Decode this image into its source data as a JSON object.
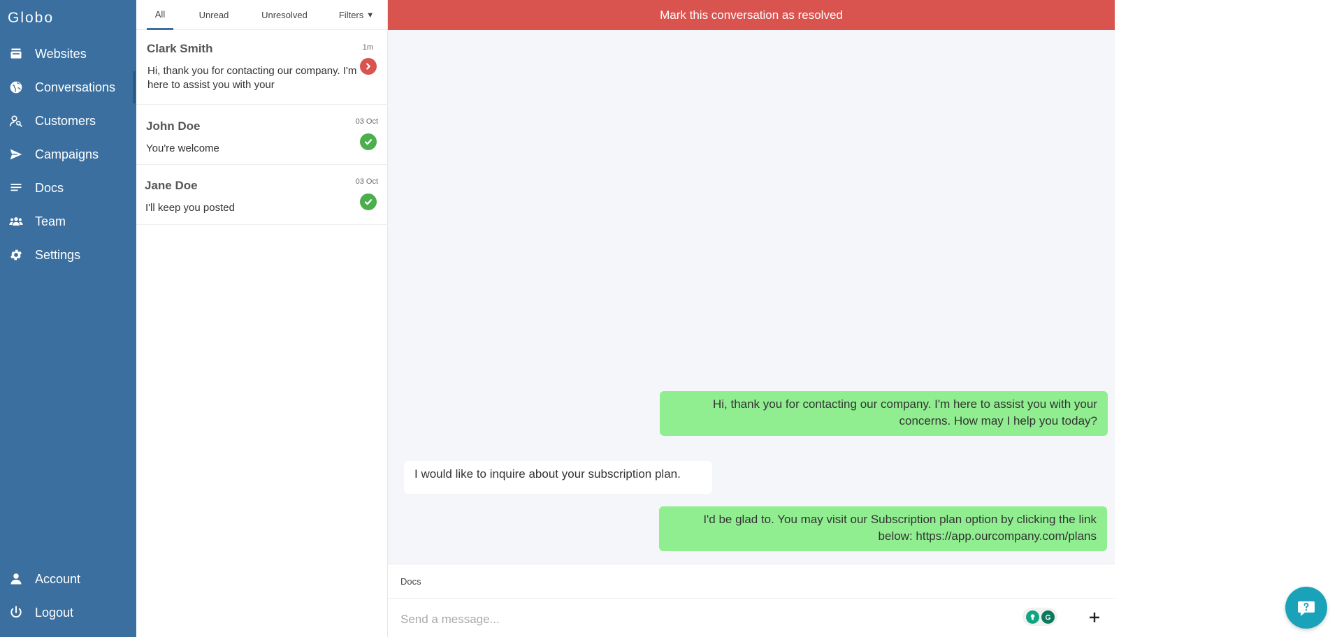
{
  "brand": "Globo",
  "nav": {
    "items": [
      {
        "label": "Websites",
        "icon": "websites-icon"
      },
      {
        "label": "Conversations",
        "icon": "globe-icon"
      },
      {
        "label": "Customers",
        "icon": "customers-icon"
      },
      {
        "label": "Campaigns",
        "icon": "send-icon"
      },
      {
        "label": "Docs",
        "icon": "docs-icon"
      },
      {
        "label": "Team",
        "icon": "team-icon"
      },
      {
        "label": "Settings",
        "icon": "gear-icon"
      }
    ],
    "bottom": [
      {
        "label": "Account",
        "icon": "user-icon"
      },
      {
        "label": "Logout",
        "icon": "power-icon"
      }
    ]
  },
  "tabs": {
    "all": "All",
    "unread": "Unread",
    "unresolved": "Unresolved",
    "filters": "Filters"
  },
  "conversations": [
    {
      "name": "Clark Smith",
      "preview": "Hi, thank you for contacting our company. I'm here to assist you with your",
      "time": "1m",
      "status": "open"
    },
    {
      "name": "John Doe",
      "preview": "You're welcome",
      "time": "03 Oct",
      "status": "resolved"
    },
    {
      "name": "Jane Doe",
      "preview": "I'll keep you posted",
      "time": "03 Oct",
      "status": "resolved"
    }
  ],
  "chat": {
    "resolve_label": "Mark this conversation as resolved",
    "messages": [
      {
        "direction": "out",
        "text": "Hi, thank you for contacting our company. I'm here to assist you with your concerns. How may I help you today?"
      },
      {
        "direction": "in",
        "text": "I would like to inquire about your subscription plan."
      },
      {
        "direction": "out",
        "text": "I'd be glad to. You may visit our Subscription plan option by clicking the link below: https://app.ourcompany.com/plans"
      }
    ],
    "docs_link": "Docs",
    "input_placeholder": "Send a message..."
  },
  "colors": {
    "sidebar": "#3a6f9f",
    "resolve_bar": "#d9534f",
    "outgoing_bubble": "#90ee90",
    "resolved_badge": "#4cae4c",
    "open_badge": "#d9534f",
    "help_button": "#1aa3b8"
  }
}
